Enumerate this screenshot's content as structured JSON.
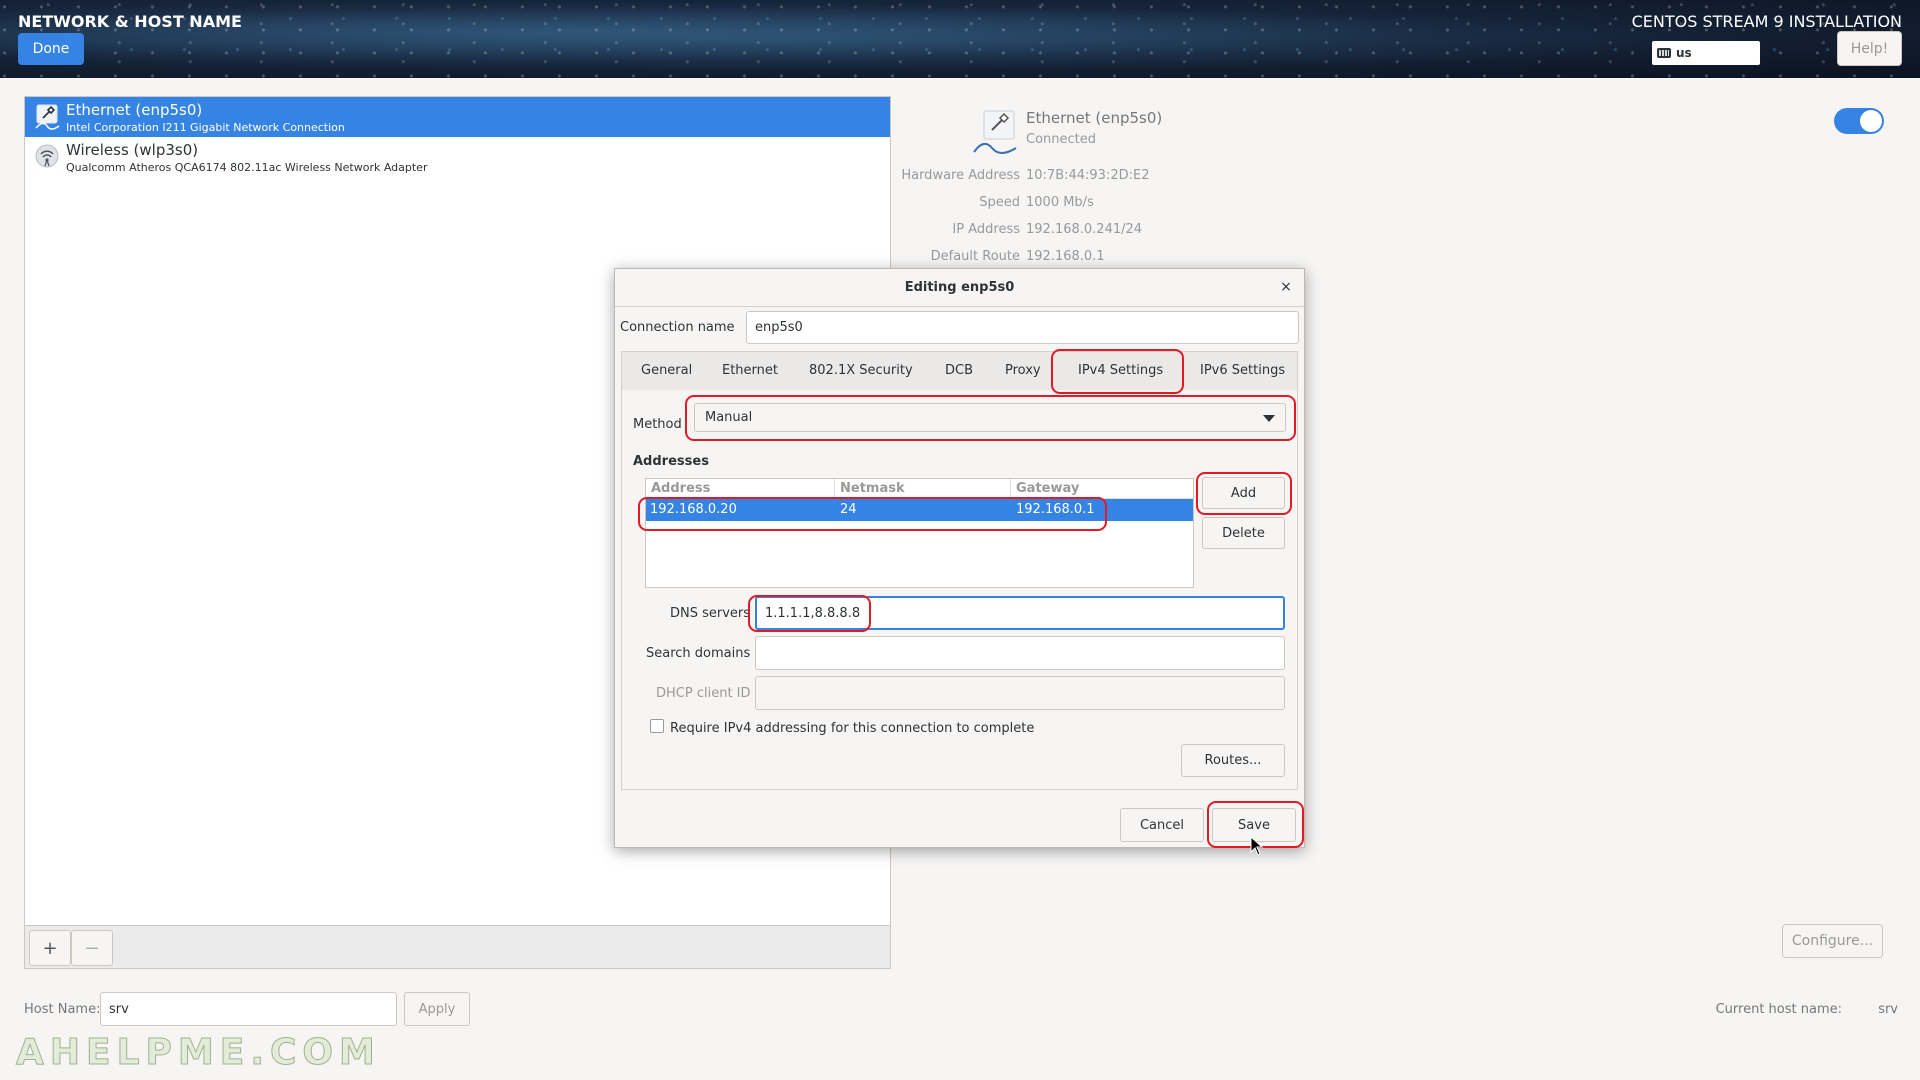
{
  "header": {
    "title": "NETWORK & HOST NAME",
    "done_label": "Done",
    "installer_title": "CENTOS STREAM 9 INSTALLATION",
    "keyboard_layout": "us",
    "help_label": "Help!"
  },
  "devices": [
    {
      "name": "Ethernet (enp5s0)",
      "description": "Intel Corporation I211 Gigabit Network Connection",
      "icon": "ethernet-icon",
      "selected": true
    },
    {
      "name": "Wireless (wlp3s0)",
      "description": "Qualcomm Atheros QCA6174 802.11ac Wireless Network Adapter",
      "icon": "wireless-icon",
      "selected": false
    }
  ],
  "device_toolbar": {
    "add_label": "+",
    "remove_label": "−"
  },
  "details": {
    "name": "Ethernet (enp5s0)",
    "status": "Connected",
    "enabled": true,
    "properties": [
      {
        "label": "Hardware Address",
        "value": "10:7B:44:93:2D:E2"
      },
      {
        "label": "Speed",
        "value": "1000 Mb/s"
      },
      {
        "label": "IP Address",
        "value": "192.168.0.241/24"
      },
      {
        "label": "Default Route",
        "value": "192.168.0.1"
      }
    ],
    "configure_label": "Configure..."
  },
  "host": {
    "label": "Host Name:",
    "value": "srv",
    "apply_label": "Apply",
    "current_label": "Current host name:",
    "current_value": "srv"
  },
  "watermark": "AHELPME.COM",
  "dialog": {
    "title": "Editing enp5s0",
    "close_glyph": "×",
    "connection_name_label": "Connection name",
    "connection_name_value": "enp5s0",
    "tabs": [
      "General",
      "Ethernet",
      "802.1X Security",
      "DCB",
      "Proxy",
      "IPv4 Settings",
      "IPv6 Settings"
    ],
    "active_tab": "IPv4 Settings",
    "method_label": "Method",
    "method_value": "Manual",
    "addresses_label": "Addresses",
    "columns": [
      "Address",
      "Netmask",
      "Gateway"
    ],
    "rows": [
      {
        "address": "192.168.0.20",
        "netmask": "24",
        "gateway": "192.168.0.1"
      }
    ],
    "add_label": "Add",
    "delete_label": "Delete",
    "dns_label": "DNS servers",
    "dns_value": "1.1.1.1,8.8.8.8",
    "search_label": "Search domains",
    "search_value": "",
    "dhcp_label": "DHCP client ID",
    "dhcp_value": "",
    "require_label": "Require IPv4 addressing for this connection to complete",
    "require_checked": false,
    "routes_label": "Routes...",
    "cancel_label": "Cancel",
    "save_label": "Save"
  },
  "colors": {
    "accent": "#3584e4",
    "annotation": "#e01b24"
  }
}
